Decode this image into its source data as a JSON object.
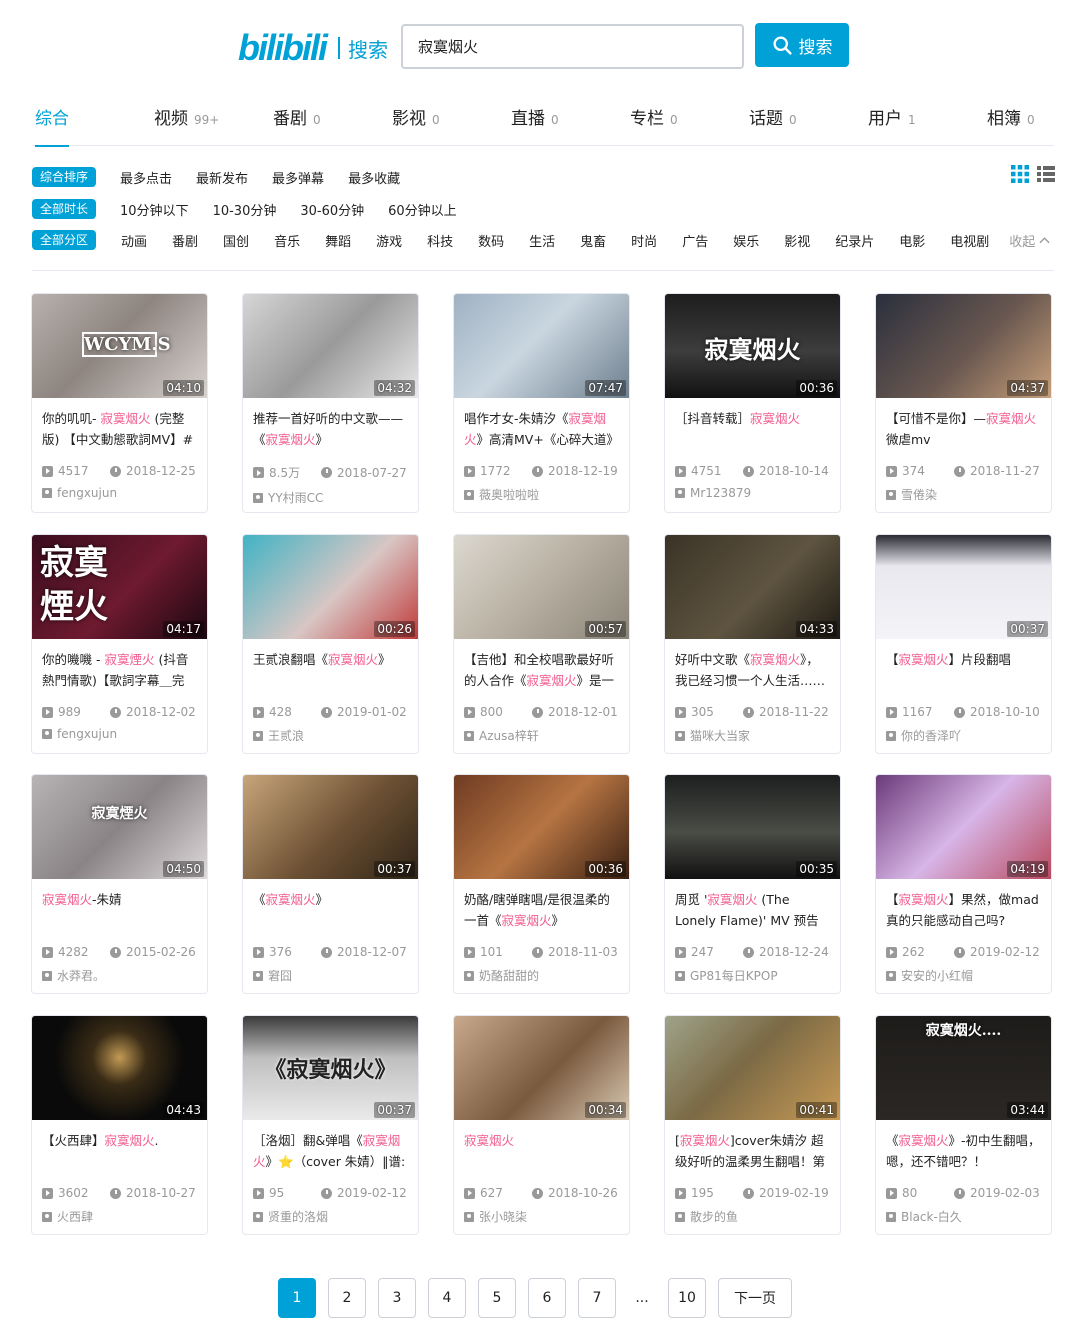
{
  "header": {
    "logo": "bilibili",
    "logo_section": "搜索",
    "search_value": "寂寞烟火",
    "search_button": "搜索"
  },
  "type_tabs": [
    {
      "label": "综合",
      "count": ""
    },
    {
      "label": "视频",
      "count": "99+"
    },
    {
      "label": "番剧",
      "count": "0"
    },
    {
      "label": "影视",
      "count": "0"
    },
    {
      "label": "直播",
      "count": "0"
    },
    {
      "label": "专栏",
      "count": "0"
    },
    {
      "label": "话题",
      "count": "0"
    },
    {
      "label": "用户",
      "count": "1"
    },
    {
      "label": "相簿",
      "count": "0"
    }
  ],
  "filters": {
    "sort": {
      "active": "综合排序",
      "options": [
        "最多点击",
        "最新发布",
        "最多弹幕",
        "最多收藏"
      ]
    },
    "duration": {
      "active": "全部时长",
      "options": [
        "10分钟以下",
        "10-30分钟",
        "30-60分钟",
        "60分钟以上"
      ]
    },
    "zone": {
      "active": "全部分区",
      "options": [
        "动画",
        "番剧",
        "国创",
        "音乐",
        "舞蹈",
        "游戏",
        "科技",
        "数码",
        "生活",
        "鬼畜",
        "时尚",
        "广告",
        "娱乐",
        "影视",
        "纪录片",
        "电影",
        "电视剧"
      ],
      "collapse": "收起"
    }
  },
  "videos": [
    {
      "pre": "你的叽叽- ",
      "hl": "寂寞烟火",
      "post": " (完整版) 【中文動態歌詞MV】#",
      "duration": "04:10",
      "views": "4517",
      "date": "2018-12-25",
      "up": "fengxujun",
      "overlay": "WCYM.S"
    },
    {
      "pre": "推荐一首好听的中文歌——《",
      "hl": "寂寞烟火",
      "post": "》",
      "duration": "04:32",
      "views": "8.5万",
      "date": "2018-07-27",
      "up": "YY村雨CC",
      "overlay": ""
    },
    {
      "pre": "唱作才女-朱婧汐《",
      "hl": "寂寞烟火",
      "post": "》高清MV+《心碎大道》",
      "duration": "07:47",
      "views": "1772",
      "date": "2018-12-19",
      "up": "薇奥啦啦啦",
      "overlay": ""
    },
    {
      "pre": "［抖音转载］",
      "hl": "寂寞烟火",
      "post": "",
      "duration": "00:36",
      "views": "4751",
      "date": "2018-10-14",
      "up": "Mr123879",
      "overlay": "寂寞烟火"
    },
    {
      "pre": "【可惜不是你】—",
      "hl": "寂寞烟火",
      "post": "微虐mv",
      "duration": "04:37",
      "views": "374",
      "date": "2018-11-27",
      "up": "雪倦染",
      "overlay": ""
    },
    {
      "pre": "你的嘰嘰 - ",
      "hl": "寂寞煙火",
      "post": " (抖音熱門情歌)【歌詞字幕＿完",
      "duration": "04:17",
      "views": "989",
      "date": "2018-12-02",
      "up": "fengxujun",
      "overlay": "寂寞煙火"
    },
    {
      "pre": "王贰浪翻唱《",
      "hl": "寂寞烟火",
      "post": "》",
      "duration": "00:26",
      "views": "428",
      "date": "2019-01-02",
      "up": "王贰浪",
      "overlay": ""
    },
    {
      "pre": "【吉他】和全校唱歌最好听的人合作《",
      "hl": "寂寞烟火",
      "post": "》是一",
      "duration": "00:57",
      "views": "800",
      "date": "2018-12-01",
      "up": "Azusa梓轩",
      "overlay": ""
    },
    {
      "pre": "好听中文歌《",
      "hl": "寂寞烟火",
      "post": "》，我已经习惯一个人生活……",
      "duration": "04:33",
      "views": "305",
      "date": "2018-11-22",
      "up": "猫咪大当家",
      "overlay": ""
    },
    {
      "pre": "【",
      "hl": "寂寞烟火",
      "post": "】片段翻唱",
      "duration": "00:37",
      "views": "1167",
      "date": "2018-10-10",
      "up": "你的香泽吖",
      "overlay": ""
    },
    {
      "pre": "",
      "hl": "寂寞烟火",
      "post": "-朱婧",
      "duration": "04:50",
      "views": "4282",
      "date": "2015-02-26",
      "up": "水莽君。",
      "overlay": "寂寞煙火"
    },
    {
      "pre": "《",
      "hl": "寂寞烟火",
      "post": "》",
      "duration": "00:37",
      "views": "376",
      "date": "2018-12-07",
      "up": "窘囧",
      "overlay": ""
    },
    {
      "pre": "奶酪/瞎弹瞎唱/是很温柔的一首《",
      "hl": "寂寞烟火",
      "post": "》",
      "duration": "00:36",
      "views": "101",
      "date": "2018-11-03",
      "up": "奶酪甜甜的",
      "overlay": ""
    },
    {
      "pre": "周觅 '",
      "hl": "寂寞烟火",
      "post": " (The Lonely Flame)' MV 预告",
      "duration": "00:35",
      "views": "247",
      "date": "2018-12-24",
      "up": "GP81每日KPOP",
      "overlay": ""
    },
    {
      "pre": "【",
      "hl": "寂寞烟火",
      "post": "】果然，做mad真的只能感动自己吗?",
      "duration": "04:19",
      "views": "262",
      "date": "2019-02-12",
      "up": "安安的小红帽",
      "overlay": ""
    },
    {
      "pre": "【火西肆】",
      "hl": "寂寞烟火",
      "post": ".",
      "duration": "04:43",
      "views": "3602",
      "date": "2018-10-27",
      "up": "火西肆",
      "overlay": ""
    },
    {
      "pre": "［洛烟］翻&弹唱《",
      "hl": "寂寞烟火",
      "post": "》⭐（cover 朱婧）‖谱:",
      "duration": "00:37",
      "views": "95",
      "date": "2019-02-12",
      "up": "贤重的洛烟",
      "overlay": "《寂寞烟火》"
    },
    {
      "pre": "",
      "hl": "寂寞烟火",
      "post": "",
      "duration": "00:34",
      "views": "627",
      "date": "2018-10-26",
      "up": "张小晓柒",
      "overlay": ""
    },
    {
      "pre": "[",
      "hl": "寂寞烟火",
      "post": "]cover朱婧汐 超级好听的温柔男生翻唱！第一",
      "duration": "00:41",
      "views": "195",
      "date": "2019-02-19",
      "up": "散步的鱼",
      "overlay": ""
    },
    {
      "pre": "《",
      "hl": "寂寞烟火",
      "post": "》-初中生翻唱，嗯，还不错吧？！",
      "duration": "03:44",
      "views": "80",
      "date": "2019-02-03",
      "up": "Black-白久",
      "overlay": "寂寞烟火...."
    }
  ],
  "pager": {
    "pages": [
      "1",
      "2",
      "3",
      "4",
      "5",
      "6",
      "7",
      "...",
      "10"
    ],
    "next": "下一页",
    "current": "1"
  },
  "colors": {
    "accent": "#00a1d6",
    "highlight": "#f25d8e",
    "muted": "#999999"
  }
}
